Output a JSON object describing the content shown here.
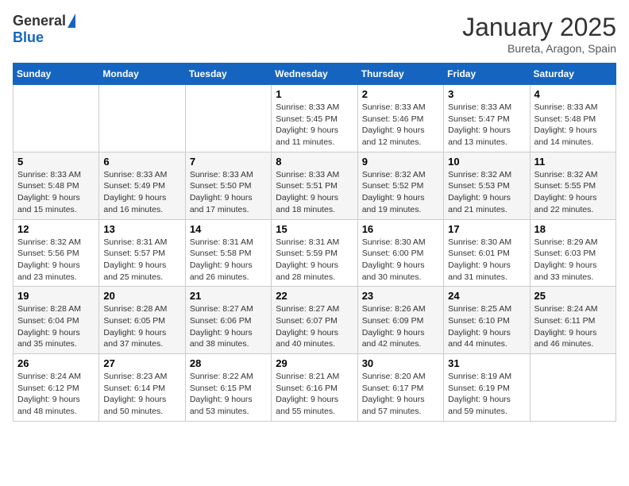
{
  "logo": {
    "general": "General",
    "blue": "Blue"
  },
  "title": "January 2025",
  "location": "Bureta, Aragon, Spain",
  "weekdays": [
    "Sunday",
    "Monday",
    "Tuesday",
    "Wednesday",
    "Thursday",
    "Friday",
    "Saturday"
  ],
  "weeks": [
    [
      {
        "day": "",
        "info": ""
      },
      {
        "day": "",
        "info": ""
      },
      {
        "day": "",
        "info": ""
      },
      {
        "day": "1",
        "info": "Sunrise: 8:33 AM\nSunset: 5:45 PM\nDaylight: 9 hours\nand 11 minutes."
      },
      {
        "day": "2",
        "info": "Sunrise: 8:33 AM\nSunset: 5:46 PM\nDaylight: 9 hours\nand 12 minutes."
      },
      {
        "day": "3",
        "info": "Sunrise: 8:33 AM\nSunset: 5:47 PM\nDaylight: 9 hours\nand 13 minutes."
      },
      {
        "day": "4",
        "info": "Sunrise: 8:33 AM\nSunset: 5:48 PM\nDaylight: 9 hours\nand 14 minutes."
      }
    ],
    [
      {
        "day": "5",
        "info": "Sunrise: 8:33 AM\nSunset: 5:48 PM\nDaylight: 9 hours\nand 15 minutes."
      },
      {
        "day": "6",
        "info": "Sunrise: 8:33 AM\nSunset: 5:49 PM\nDaylight: 9 hours\nand 16 minutes."
      },
      {
        "day": "7",
        "info": "Sunrise: 8:33 AM\nSunset: 5:50 PM\nDaylight: 9 hours\nand 17 minutes."
      },
      {
        "day": "8",
        "info": "Sunrise: 8:33 AM\nSunset: 5:51 PM\nDaylight: 9 hours\nand 18 minutes."
      },
      {
        "day": "9",
        "info": "Sunrise: 8:32 AM\nSunset: 5:52 PM\nDaylight: 9 hours\nand 19 minutes."
      },
      {
        "day": "10",
        "info": "Sunrise: 8:32 AM\nSunset: 5:53 PM\nDaylight: 9 hours\nand 21 minutes."
      },
      {
        "day": "11",
        "info": "Sunrise: 8:32 AM\nSunset: 5:55 PM\nDaylight: 9 hours\nand 22 minutes."
      }
    ],
    [
      {
        "day": "12",
        "info": "Sunrise: 8:32 AM\nSunset: 5:56 PM\nDaylight: 9 hours\nand 23 minutes."
      },
      {
        "day": "13",
        "info": "Sunrise: 8:31 AM\nSunset: 5:57 PM\nDaylight: 9 hours\nand 25 minutes."
      },
      {
        "day": "14",
        "info": "Sunrise: 8:31 AM\nSunset: 5:58 PM\nDaylight: 9 hours\nand 26 minutes."
      },
      {
        "day": "15",
        "info": "Sunrise: 8:31 AM\nSunset: 5:59 PM\nDaylight: 9 hours\nand 28 minutes."
      },
      {
        "day": "16",
        "info": "Sunrise: 8:30 AM\nSunset: 6:00 PM\nDaylight: 9 hours\nand 30 minutes."
      },
      {
        "day": "17",
        "info": "Sunrise: 8:30 AM\nSunset: 6:01 PM\nDaylight: 9 hours\nand 31 minutes."
      },
      {
        "day": "18",
        "info": "Sunrise: 8:29 AM\nSunset: 6:03 PM\nDaylight: 9 hours\nand 33 minutes."
      }
    ],
    [
      {
        "day": "19",
        "info": "Sunrise: 8:28 AM\nSunset: 6:04 PM\nDaylight: 9 hours\nand 35 minutes."
      },
      {
        "day": "20",
        "info": "Sunrise: 8:28 AM\nSunset: 6:05 PM\nDaylight: 9 hours\nand 37 minutes."
      },
      {
        "day": "21",
        "info": "Sunrise: 8:27 AM\nSunset: 6:06 PM\nDaylight: 9 hours\nand 38 minutes."
      },
      {
        "day": "22",
        "info": "Sunrise: 8:27 AM\nSunset: 6:07 PM\nDaylight: 9 hours\nand 40 minutes."
      },
      {
        "day": "23",
        "info": "Sunrise: 8:26 AM\nSunset: 6:09 PM\nDaylight: 9 hours\nand 42 minutes."
      },
      {
        "day": "24",
        "info": "Sunrise: 8:25 AM\nSunset: 6:10 PM\nDaylight: 9 hours\nand 44 minutes."
      },
      {
        "day": "25",
        "info": "Sunrise: 8:24 AM\nSunset: 6:11 PM\nDaylight: 9 hours\nand 46 minutes."
      }
    ],
    [
      {
        "day": "26",
        "info": "Sunrise: 8:24 AM\nSunset: 6:12 PM\nDaylight: 9 hours\nand 48 minutes."
      },
      {
        "day": "27",
        "info": "Sunrise: 8:23 AM\nSunset: 6:14 PM\nDaylight: 9 hours\nand 50 minutes."
      },
      {
        "day": "28",
        "info": "Sunrise: 8:22 AM\nSunset: 6:15 PM\nDaylight: 9 hours\nand 53 minutes."
      },
      {
        "day": "29",
        "info": "Sunrise: 8:21 AM\nSunset: 6:16 PM\nDaylight: 9 hours\nand 55 minutes."
      },
      {
        "day": "30",
        "info": "Sunrise: 8:20 AM\nSunset: 6:17 PM\nDaylight: 9 hours\nand 57 minutes."
      },
      {
        "day": "31",
        "info": "Sunrise: 8:19 AM\nSunset: 6:19 PM\nDaylight: 9 hours\nand 59 minutes."
      },
      {
        "day": "",
        "info": ""
      }
    ]
  ]
}
